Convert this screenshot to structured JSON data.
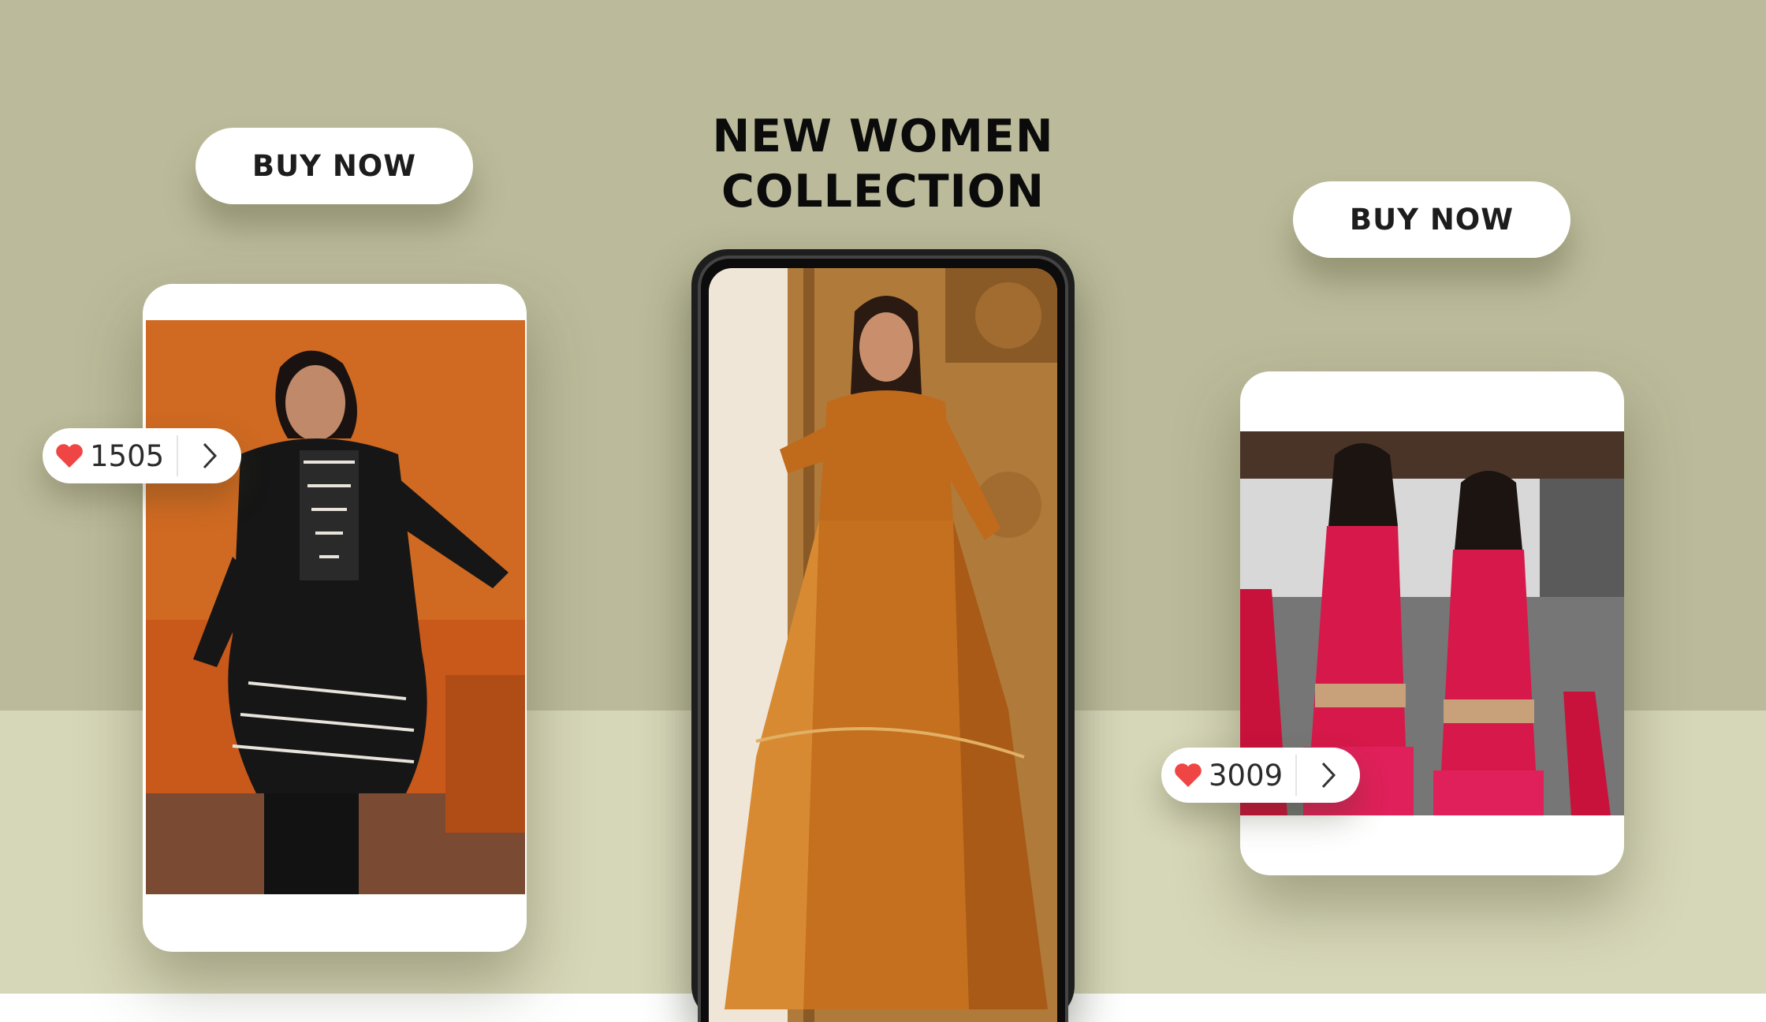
{
  "headline": {
    "line1": "NEW WOMEN",
    "line2": "COLLECTION"
  },
  "left_card": {
    "cta_label": "BUY NOW",
    "likes": "1505",
    "heart_icon": "heart-icon",
    "next_icon": "chevron-right-icon"
  },
  "right_card": {
    "cta_label": "BUY NOW",
    "likes": "3009",
    "heart_icon": "heart-icon",
    "next_icon": "chevron-right-icon"
  },
  "colors": {
    "background_top": "#bbbb9b",
    "background_bottom": "#d6d6b8",
    "heart": "#f04545",
    "text": "#1d1d1d"
  }
}
